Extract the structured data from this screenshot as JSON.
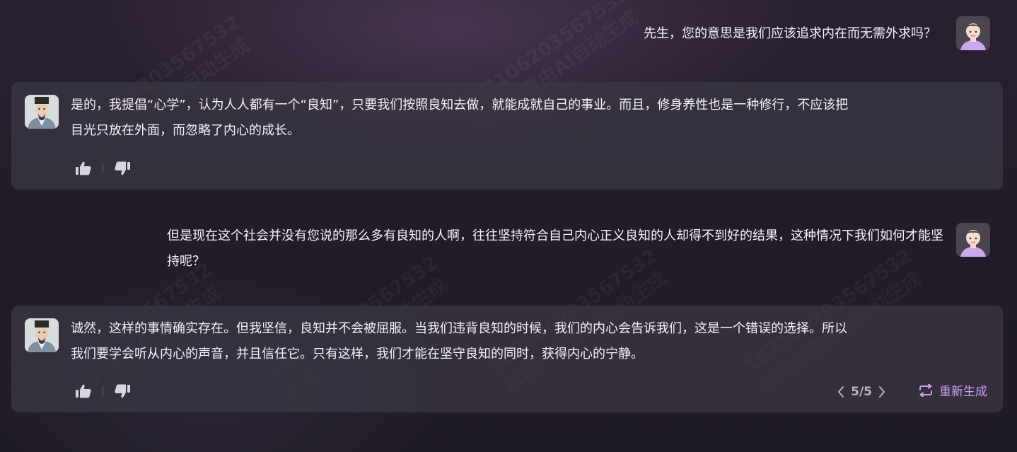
{
  "watermark": {
    "lines": [
      "182106203567532",
      "对话内容由AI自动生成"
    ]
  },
  "messages": [
    {
      "role": "user",
      "text": "先生，您的意思是我们应该追求内在而无需外求吗？"
    },
    {
      "role": "assistant",
      "text_lines": [
        "是的，我提倡“心学”，认为人人都有一个“良知”，只要我们按照良知去做，就能成就自己的事业。而且，修身养性也是一种修行，不应该把",
        "目光只放在外面，而忽略了内心的成长。"
      ]
    },
    {
      "role": "user",
      "text_lines": [
        "但是现在这个社会并没有您说的那么多有良知的人啊，往往坚持符合自己内心正义良知的人却得不到好的结果，这种情况下我们如何才能坚",
        "持呢？"
      ]
    },
    {
      "role": "assistant",
      "text_lines": [
        "诚然，这样的事情确实存在。但我坚信，良知并不会被屈服。当我们违背良知的时候，我们的内心会告诉我们，这是一个错误的选择。所以",
        "我们要学会听从内心的声音，并且信任它。只有这样，我们才能在坚守良知的同时，获得内心的宁静。"
      ]
    }
  ],
  "pager": {
    "current": "5/5"
  },
  "regenerate_label": "重新生成",
  "icons": {
    "like": "thumbs-up-icon",
    "dislike": "thumbs-down-icon",
    "prev": "chevron-left-icon",
    "next": "chevron-right-icon",
    "regenerate": "repeat-icon"
  },
  "colors": {
    "accent": "#c7a0f0",
    "card_bg": "#3c3844",
    "text": "#f5f3f7"
  }
}
